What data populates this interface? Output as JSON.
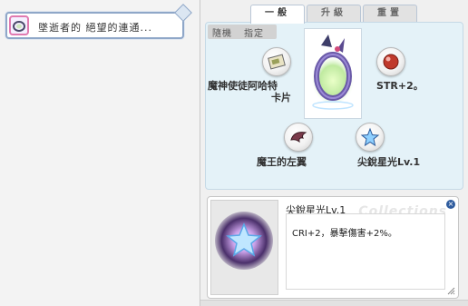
{
  "equipped_chip": {
    "text": "墜逝者的 絕望的連通..."
  },
  "tabs": [
    {
      "label": "一般",
      "active": true
    },
    {
      "label": "升級",
      "active": false
    },
    {
      "label": "重置",
      "active": false
    }
  ],
  "filters": {
    "random": "隨機",
    "specify": "指定"
  },
  "center_item": {
    "icon": "ring-icon"
  },
  "slots": {
    "top_left": {
      "line1": "魔神使徒阿哈特",
      "line2": "卡片",
      "icon": "card-icon"
    },
    "top_right": {
      "label": "STR+2。",
      "icon": "red-orb-icon"
    },
    "bottom_left": {
      "label": "魔王的左翼",
      "icon": "wing-icon"
    },
    "bottom_right": {
      "label": "尖銳星光Lv.1",
      "icon": "star-icon"
    }
  },
  "detail": {
    "title": "尖銳星光Lv.1",
    "watermark": "Collections",
    "description": "CRI+2，暴擊傷害+2%。",
    "image_icon": "star-icon"
  },
  "colors": {
    "card_area_bg": "#e4f2f8",
    "chip_border": "#8fa7c8",
    "close_button": "#2f5c9e"
  }
}
